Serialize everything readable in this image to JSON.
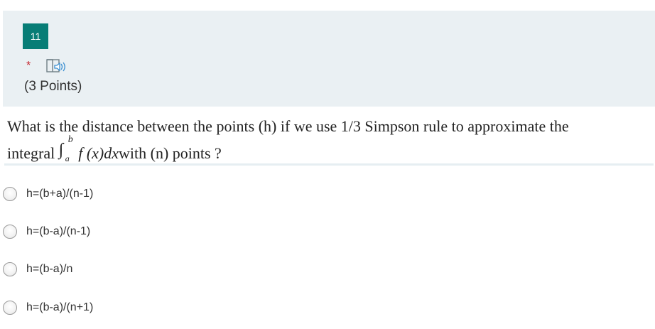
{
  "question": {
    "number": "11",
    "required_marker": "*",
    "audio_icon": "immersive-reader-icon",
    "points": "(3 Points)",
    "text_line1": "What is the distance between the points (h) if we use 1/3 Simpson rule to approximate the",
    "text_line2_prefix": "integral",
    "integral_sign": "∫",
    "integral_upper": "b",
    "integral_lower": "a",
    "integrand": "f (x)dx",
    "text_line2_suffix": "with (n) points ?"
  },
  "options": [
    {
      "label": "h=(b+a)/(n-1)"
    },
    {
      "label": "h=(b-a)/(n-1)"
    },
    {
      "label": "h=(b-a)/n"
    },
    {
      "label": "h=(b-a)/(n+1)"
    }
  ],
  "colors": {
    "badge": "#077d76",
    "panel": "#eaf0f3",
    "required": "#c4262e"
  }
}
